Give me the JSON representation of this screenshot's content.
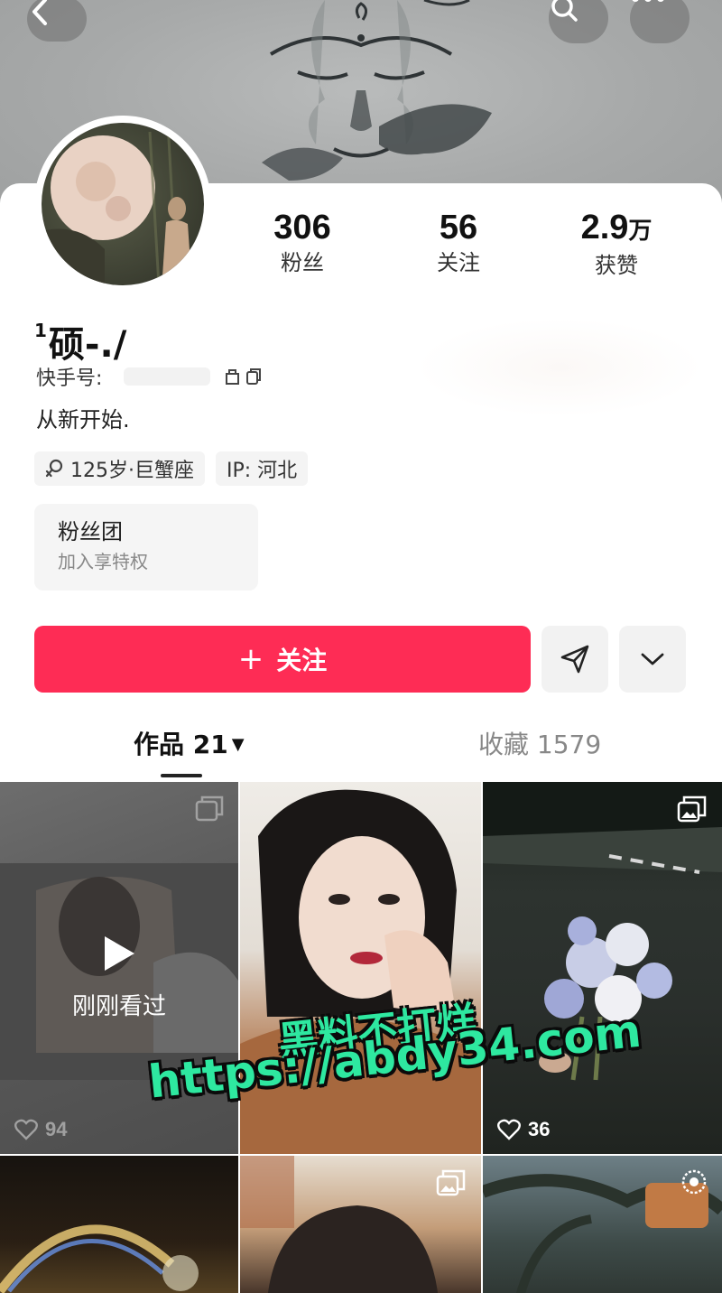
{
  "header": {
    "back_icon": "chevron-left-icon",
    "search_icon": "search-icon",
    "more_icon": "more-dots-icon"
  },
  "profile": {
    "nickname_sup": "1",
    "nickname": "硕-./",
    "id_label": "快手号:",
    "bio": "从新开始."
  },
  "stats": [
    {
      "value": "306",
      "unit": "",
      "label": "粉丝"
    },
    {
      "value": "56",
      "unit": "",
      "label": "关注"
    },
    {
      "value": "2.9",
      "unit": "万",
      "label": "获赞"
    }
  ],
  "tags": {
    "age": "125岁·巨蟹座",
    "ip": "IP:  河北"
  },
  "fan_club": {
    "title": "粉丝团",
    "subtitle": "加入享特权"
  },
  "actions": {
    "follow_plus": "+",
    "follow_label": "关注"
  },
  "tabs": {
    "works_label": "作品 21",
    "works_caret": "▼",
    "favorites_label": "收藏 1579"
  },
  "grid": {
    "recently_watched": "刚刚看过",
    "item1_likes": "94",
    "item3_likes": "36"
  },
  "watermark": {
    "line1": "黑料不打烊",
    "line2": "https://abdy34.com"
  },
  "colors": {
    "accent": "#fe2c55",
    "watermark": "#2ee8a0"
  }
}
